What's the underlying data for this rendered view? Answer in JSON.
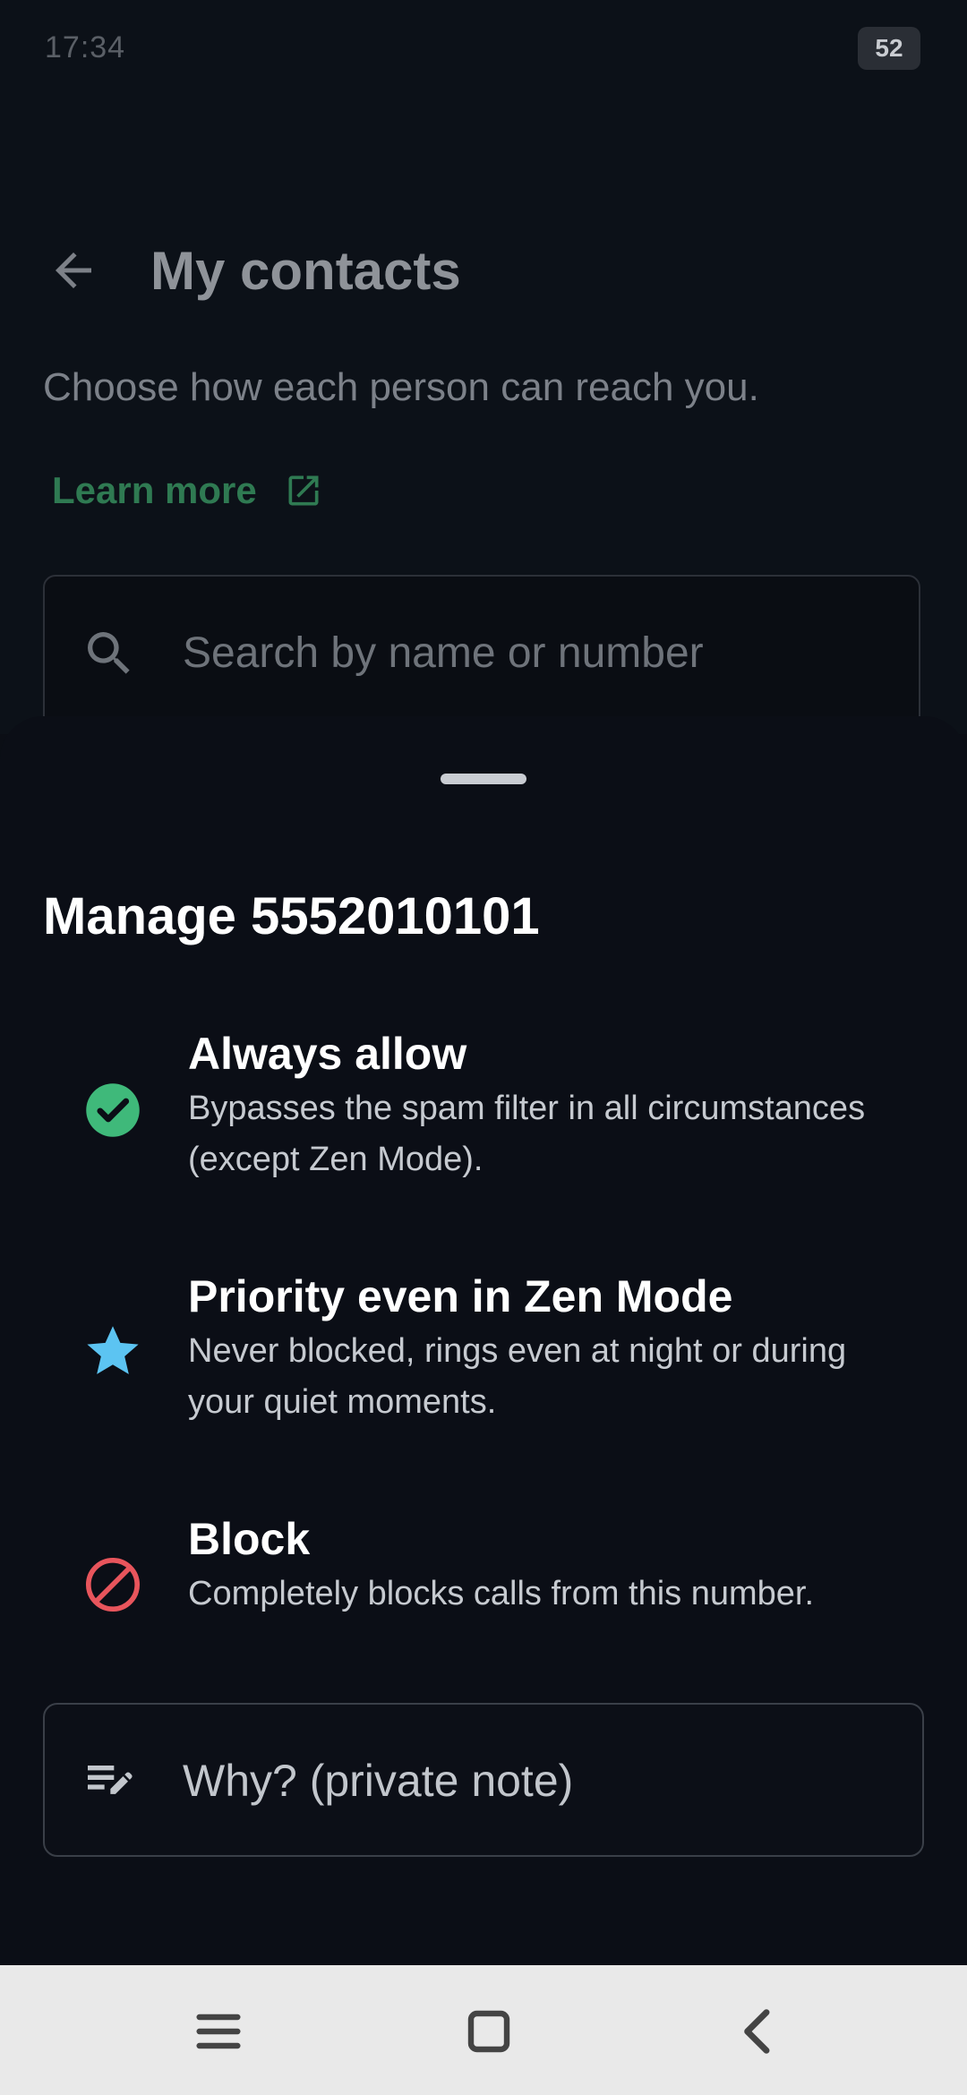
{
  "status_bar": {
    "time": "17:34",
    "battery": "52"
  },
  "app_bar": {
    "title": "My contacts",
    "back_icon": "arrow-left-icon"
  },
  "intro": {
    "subtitle": "Choose how each person can reach you.",
    "learn_more_label": "Learn more",
    "learn_more_icon": "external-link-icon"
  },
  "search": {
    "placeholder": "Search by name or number",
    "icon": "search-icon"
  },
  "sheet": {
    "title": "Manage 5552010101",
    "options": [
      {
        "icon": "check-circle-icon",
        "color": "#3fb97a",
        "title": "Always allow",
        "description": "Bypasses the spam filter in all circumstances (except Zen Mode)."
      },
      {
        "icon": "star-icon",
        "color": "#5cc4f2",
        "title": "Priority even in Zen Mode",
        "description": "Never blocked, rings even at night or during your quiet moments."
      },
      {
        "icon": "block-icon",
        "color": "#e8555c",
        "title": "Block",
        "description": "Completely blocks calls from this number."
      }
    ],
    "note": {
      "placeholder": "Why? (private note)",
      "icon": "edit-note-icon"
    }
  },
  "nav_bar": {
    "buttons": [
      "menu-icon",
      "home-square-icon",
      "back-chevron-icon"
    ]
  },
  "colors": {
    "accent_green": "#2f7a52",
    "sheet_bg": "#0b0e16",
    "background": "#0c1118"
  }
}
